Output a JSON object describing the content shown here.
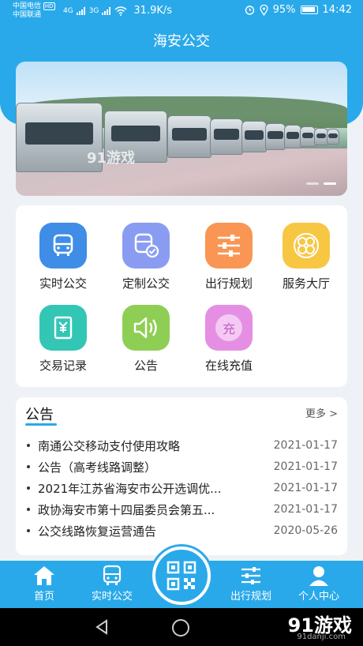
{
  "status_bar": {
    "carrier_1": "中国电信",
    "carrier_2": "中国联通",
    "hd": "HD",
    "net_1": "4G",
    "net_2": "3G",
    "speed": "31.9K/s",
    "battery": "95%",
    "time": "14:42"
  },
  "header": {
    "title": "海安公交"
  },
  "banner": {
    "watermark": "91游戏",
    "slide_count": 2,
    "active_slide": 2
  },
  "services": [
    {
      "label": "实时公交",
      "icon": "bus-icon",
      "color": "#3f8de6"
    },
    {
      "label": "定制公交",
      "icon": "custom-bus-icon",
      "color": "#8a9cf2"
    },
    {
      "label": "出行规划",
      "icon": "sliders-icon",
      "color": "#f99653"
    },
    {
      "label": "服务大厅",
      "icon": "clover-icon",
      "color": "#f7c744"
    },
    {
      "label": "交易记录",
      "icon": "receipt-icon",
      "color": "#33c6b5"
    },
    {
      "label": "公告",
      "icon": "speaker-icon",
      "color": "#8fce55"
    },
    {
      "label": "在线充值",
      "icon": "recharge-icon",
      "color": "#e58fe4",
      "glyph": "充"
    }
  ],
  "notices": {
    "title": "公告",
    "more": "更多 >",
    "items": [
      {
        "text": "南通公交移动支付使用攻略",
        "date": "2021-01-17"
      },
      {
        "text": "公告（高考线路调整）",
        "date": "2021-01-17"
      },
      {
        "text": "2021年江苏省海安市公开选调优...",
        "date": "2021-01-17"
      },
      {
        "text": "政协海安市第十四届委员会第五...",
        "date": "2021-01-17"
      },
      {
        "text": "公交线路恢复运营通告",
        "date": "2020-05-26"
      }
    ]
  },
  "tabbar": {
    "home": "首页",
    "realtime": "实时公交",
    "planning": "出行规划",
    "profile": "个人中心"
  },
  "watermark": {
    "main": "91游戏",
    "sub": "91danji.com"
  },
  "colors": {
    "primary": "#2aa9ea"
  }
}
